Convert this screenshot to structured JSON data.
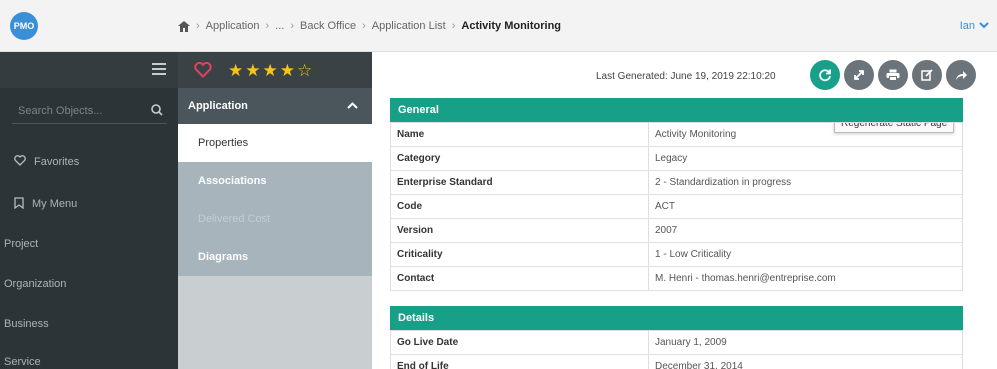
{
  "header": {
    "logo_text": "PMO",
    "breadcrumb": [
      "Application",
      "...",
      "Back Office",
      "Application List"
    ],
    "current": "Activity Monitoring",
    "user": "Ian"
  },
  "sidebar": {
    "search_placeholder": "Search Objects...",
    "items": [
      {
        "label": "Favorites",
        "icon": "heart-icon"
      },
      {
        "label": "My Menu",
        "icon": "bookmark-icon"
      },
      {
        "label": "Project"
      },
      {
        "label": "Organization"
      },
      {
        "label": "Business"
      },
      {
        "label": "Service"
      }
    ]
  },
  "rating": {
    "stars_filled": 4,
    "stars_total": 5
  },
  "subnav": {
    "header": "Application",
    "items": [
      "Properties",
      "Associations",
      "Delivered Cost",
      "Diagrams"
    ]
  },
  "main": {
    "last_generated": "Last Generated: June 19, 2019 22:10:20",
    "tooltip": "Regenerate Static Page",
    "general": {
      "title": "General",
      "rows": [
        {
          "k": "Name",
          "v": "Activity Monitoring"
        },
        {
          "k": "Category",
          "v": "Legacy"
        },
        {
          "k": "Enterprise Standard",
          "v": "2 - Standardization in progress"
        },
        {
          "k": "Code",
          "v": "ACT"
        },
        {
          "k": "Version",
          "v": "2007"
        },
        {
          "k": "Criticality",
          "v": "1 - Low Criticality"
        },
        {
          "k": "Contact",
          "v": "M. Henri - thomas.henri@entreprise.com"
        }
      ]
    },
    "details": {
      "title": "Details",
      "rows": [
        {
          "k": "Go Live Date",
          "v": "January 1, 2009"
        },
        {
          "k": "End of Life",
          "v": "December 31, 2014"
        }
      ]
    }
  },
  "colors": {
    "accent": "#17a087",
    "sidebar": "#2d3438",
    "star": "#f5c518",
    "heart": "#e0435c"
  }
}
